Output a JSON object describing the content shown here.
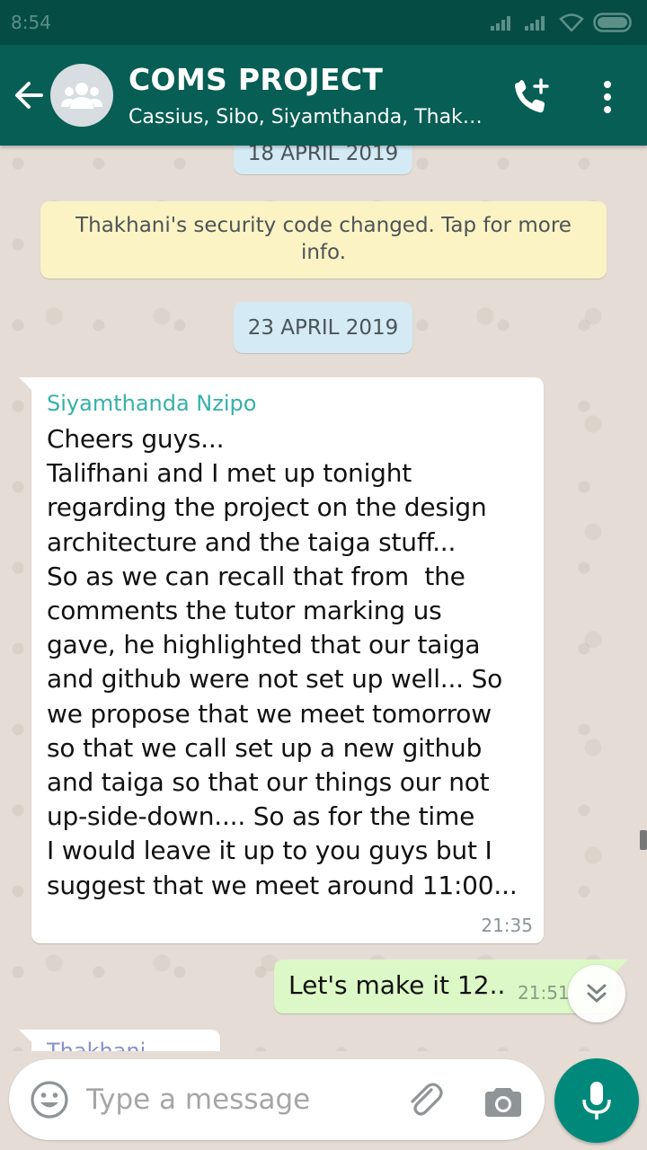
{
  "status_bar": {
    "time": "8:54"
  },
  "header": {
    "title": "COMS PROJECT",
    "subtitle": "Cassius, Sibo, Siyamthanda, Thak…",
    "accent_color": "#075e54"
  },
  "chat": {
    "date_chip_1": "18 APRIL 2019",
    "security_notice": "Thakhani's security code changed. Tap for more info.",
    "date_chip_2": "23 APRIL 2019",
    "incoming_message": {
      "sender": "Siyamthanda Nzipo",
      "text": "Cheers guys...\nTalifhani and I met up tonight\nregarding the project on the design\narchitecture and the taiga stuff...\nSo as we can recall that from  the\ncomments the tutor marking us\ngave, he highlighted that our taiga\nand github were not set up well... So\nwe propose that we meet tomorrow\nso that we call set up a new github\nand taiga so that our things our not\nup-side-down.... So as for the time\nI would leave it up to you guys but I\nsuggest that we meet around 11:00...",
      "time": "21:35"
    },
    "outgoing_message": {
      "text": "Let's make it 12..",
      "time": "21:51"
    },
    "partial_message": {
      "sender": "Thakhani"
    }
  },
  "input": {
    "placeholder": "Type a message"
  },
  "icons": {
    "back": "arrow-left-icon",
    "avatar": "group-icon",
    "call": "add-call-icon",
    "menu": "more-vert-icon",
    "emoji": "emoji-icon",
    "attach": "paperclip-icon",
    "camera": "camera-icon",
    "mic": "microphone-icon",
    "scroll": "double-chevron-down-icon"
  }
}
